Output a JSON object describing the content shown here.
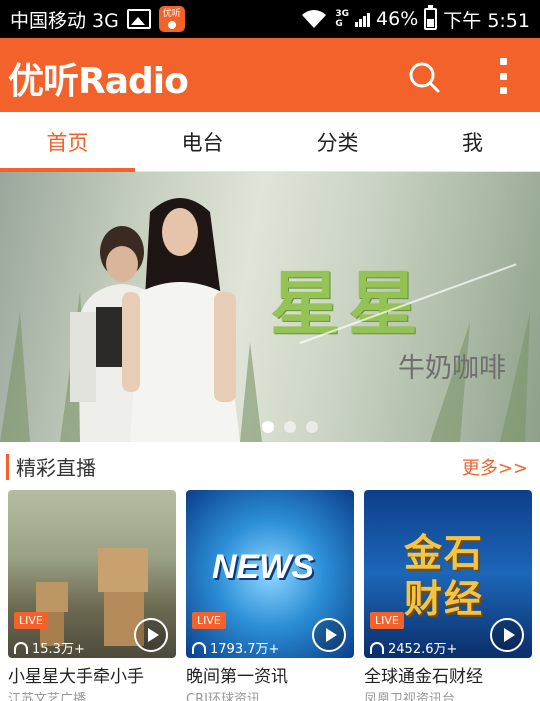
{
  "status_bar": {
    "carrier": "中国移动 3G",
    "network": "3G",
    "battery": "46%",
    "time": "下午 5:51",
    "app_icon_text": "优听"
  },
  "app_bar": {
    "logo": "优听Radio"
  },
  "tabs": [
    {
      "label": "首页",
      "active": true
    },
    {
      "label": "电台",
      "active": false
    },
    {
      "label": "分类",
      "active": false
    },
    {
      "label": "我",
      "active": false
    }
  ],
  "banner": {
    "title": "星星",
    "subtitle": "牛奶咖啡",
    "slide_count": 3,
    "active_slide": 1
  },
  "section": {
    "title": "精彩直播",
    "more": "更多>>"
  },
  "cards": [
    {
      "badge": "LIVE",
      "listeners": "15.3万+",
      "title": "小星星大手牵小手",
      "station": "江苏文艺广播",
      "image": "cardboard-robots"
    },
    {
      "badge": "LIVE",
      "listeners": "1793.7万+",
      "title": "晚间第一资讯",
      "station": "CRI环球资讯",
      "image_text": "NEWS"
    },
    {
      "badge": "LIVE",
      "listeners": "2452.6万+",
      "title": "全球通金石财经",
      "station": "凤凰卫视资讯台",
      "image_text": "金石财经"
    }
  ],
  "colors": {
    "accent": "#f2622a",
    "status_bar": "#000000"
  }
}
